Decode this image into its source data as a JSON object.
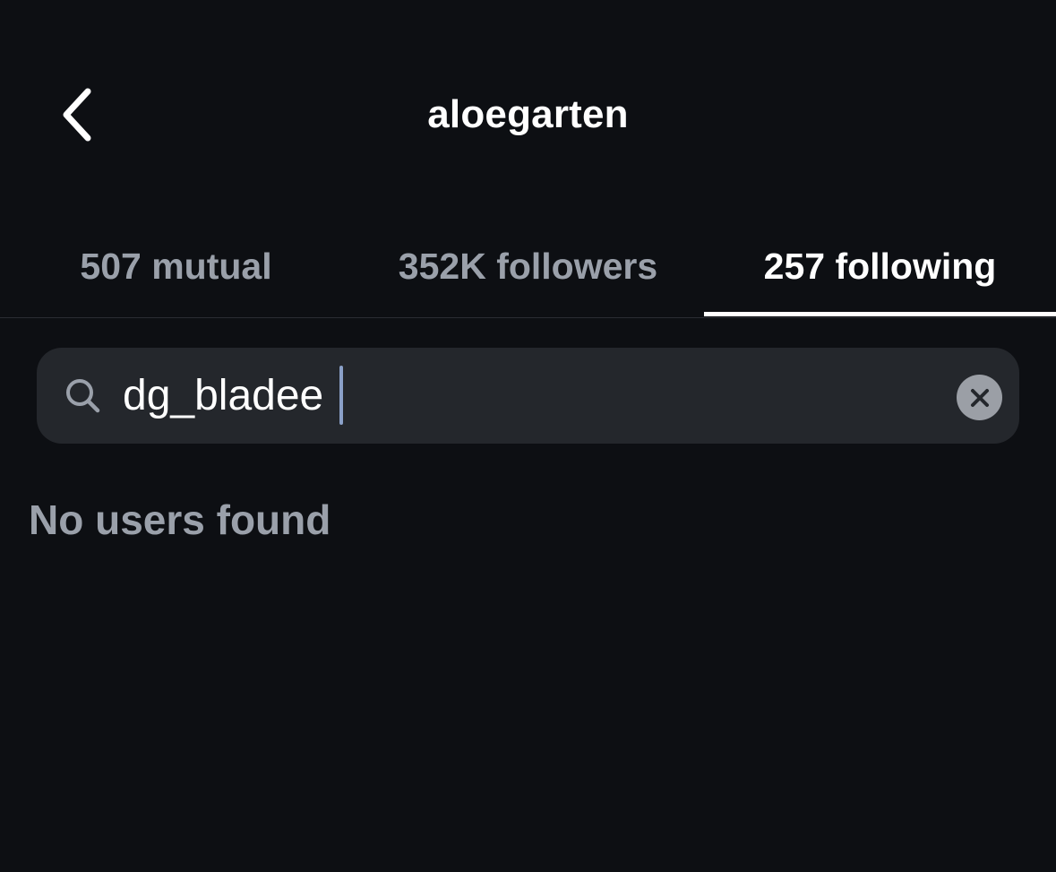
{
  "header": {
    "title": "aloegarten",
    "back_icon": "chevron-left-icon"
  },
  "tabs": [
    {
      "label": "507 mutual",
      "active": false
    },
    {
      "label": "352K followers",
      "active": false
    },
    {
      "label": "257 following",
      "active": true
    }
  ],
  "search": {
    "value": "dg_bladee",
    "search_icon": "search-icon",
    "clear_icon": "close-icon"
  },
  "results": {
    "empty_message": "No users found"
  },
  "colors": {
    "background": "#0d0f13",
    "search_background": "#24272c",
    "active_tab": "#ffffff",
    "inactive_tab": "#9aa0aa",
    "caret": "#8aa0c8",
    "clear_button": "#9b9fa6"
  }
}
